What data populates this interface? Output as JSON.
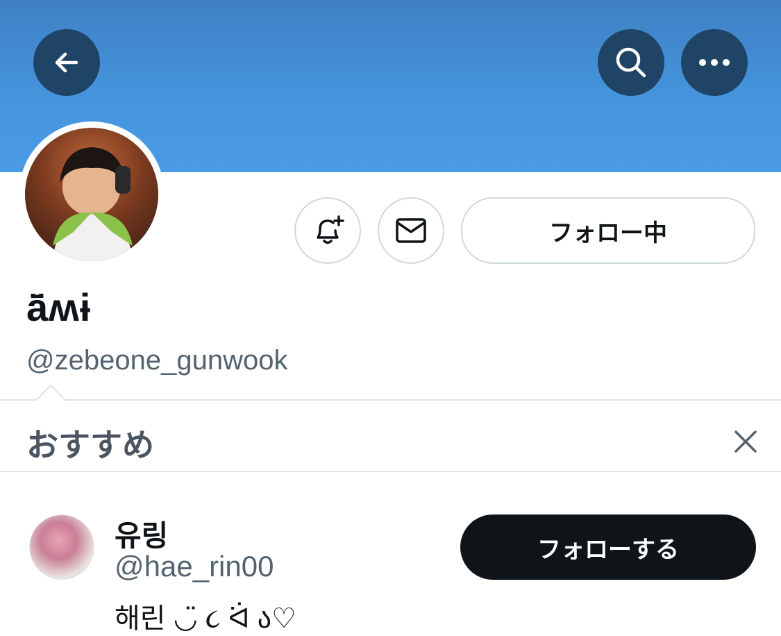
{
  "header": {
    "back_icon": "arrow-left-icon",
    "search_icon": "search-icon",
    "more_icon": "more-horizontal-icon",
    "banner_color": "#4594dc"
  },
  "profile": {
    "display_name": "ā̈ʍɨ",
    "handle": "@zebeone_gunwook",
    "following_label": "フォロー中",
    "notify_icon": "bell-plus-icon",
    "message_icon": "envelope-icon"
  },
  "recommendations": {
    "title": "おすすめ",
    "close_icon": "close-icon",
    "items": [
      {
        "name": "유링",
        "handle": "@hae_rin00",
        "bio": "해린 ◡̈ ૮ ᐛ ა♡",
        "follow_label": "フォローする"
      }
    ]
  }
}
